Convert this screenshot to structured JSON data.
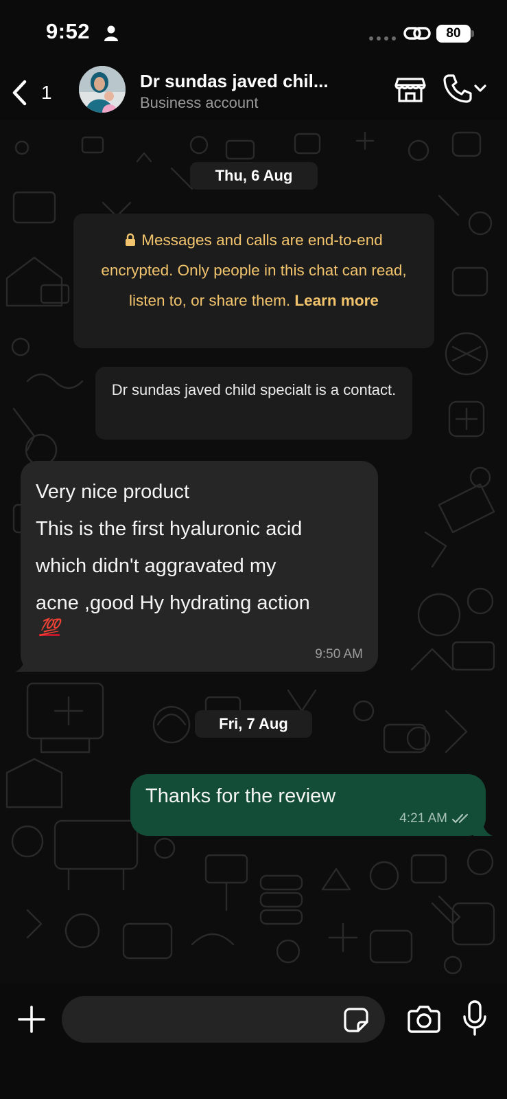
{
  "status_bar": {
    "time": "9:52",
    "battery": "80"
  },
  "header": {
    "back_count": "1",
    "contact_name": "Dr sundas javed chil...",
    "subtitle": "Business account"
  },
  "chat": {
    "date_1": "Thu, 6 Aug",
    "encryption": {
      "text": "Messages and calls are end-to-end encrypted. Only people in this chat can read, listen to, or share them.",
      "link": "Learn more"
    },
    "contact_notice": "Dr sundas javed child specialt is a contact.",
    "incoming": {
      "lines": [
        "Very nice product",
        "This is the first hyaluronic acid",
        "which didn't aggravated my",
        "acne ,good Hy hydrating action"
      ],
      "emoji": "💯",
      "time": "9:50 AM"
    },
    "date_2": "Fri, 7 Aug",
    "outgoing": {
      "text": "Thanks for the review",
      "time": "4:21 AM"
    }
  },
  "composer": {
    "value": "",
    "placeholder": ""
  },
  "colors": {
    "background": "#0b0b0b",
    "incoming_bubble": "#262626",
    "outgoing_bubble": "#134d37",
    "encryption_text": "#f2c46d"
  },
  "icons": [
    "person-icon",
    "link-icon",
    "back-chevron-icon",
    "store-icon",
    "phone-icon",
    "chevron-down-icon",
    "lock-icon",
    "double-check-icon",
    "plus-icon",
    "sticker-icon",
    "camera-icon",
    "microphone-icon"
  ]
}
